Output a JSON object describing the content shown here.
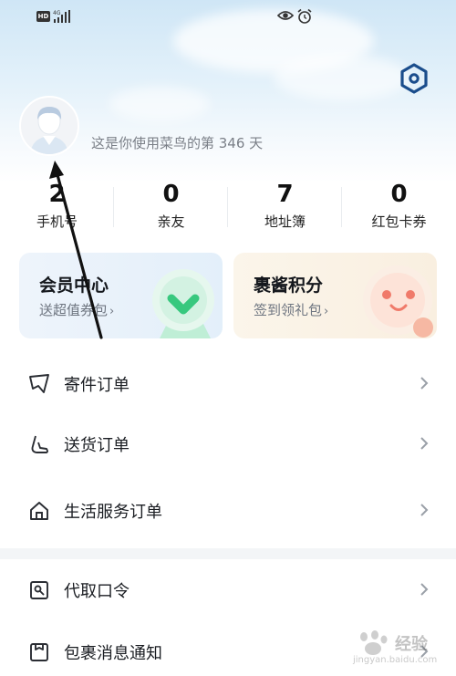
{
  "status_bar": {
    "hd": "HD",
    "network": "4G"
  },
  "profile": {
    "usage_text": "这是你使用菜鸟的第 346 天"
  },
  "stats": [
    {
      "value": "2",
      "label": "手机号"
    },
    {
      "value": "0",
      "label": "亲友"
    },
    {
      "value": "7",
      "label": "地址簿"
    },
    {
      "value": "0",
      "label": "红包卡券"
    }
  ],
  "cards": {
    "vip": {
      "title": "会员中心",
      "subtitle": "送超值券包",
      "chevron": "›"
    },
    "points": {
      "title": "裹酱积分",
      "subtitle": "签到领礼包",
      "chevron": "›"
    }
  },
  "menu": [
    {
      "label": "寄件订单",
      "icon": "paper-plane-icon"
    },
    {
      "label": "送货订单",
      "icon": "delivery-hand-icon"
    },
    {
      "label": "生活服务订单",
      "icon": "home-icon"
    },
    {
      "label": "代取口令",
      "icon": "pickup-code-icon"
    },
    {
      "label": "包裹消息通知",
      "icon": "message-box-icon"
    }
  ],
  "watermark": {
    "text": "经验",
    "url": "jingyan.baidu.com"
  },
  "colors": {
    "accent": "#1a4d8c",
    "vip_green": "#37c87e",
    "points_red": "#f07a6a"
  }
}
